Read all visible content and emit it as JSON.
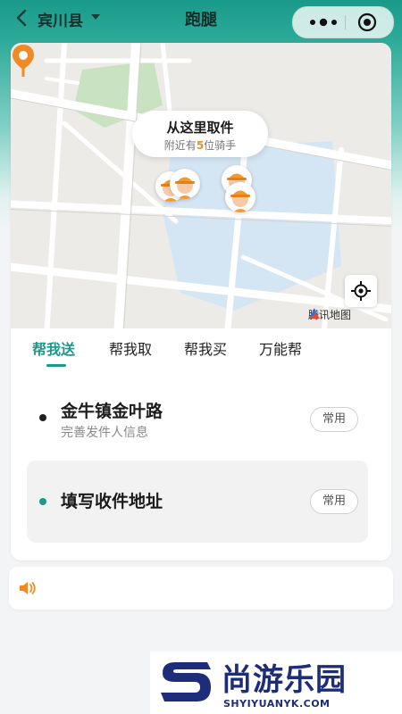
{
  "header": {
    "city": "宾川县",
    "title": "跑腿"
  },
  "map": {
    "pickup_title": "从这里取件",
    "pickup_sub_prefix": "附近有",
    "pickup_count": "5",
    "pickup_sub_suffix": "位骑手",
    "logo_text": "腾讯地图"
  },
  "tabs": [
    {
      "label": "帮我送",
      "active": true
    },
    {
      "label": "帮我取",
      "active": false
    },
    {
      "label": "帮我买",
      "active": false
    },
    {
      "label": "万能帮",
      "active": false
    }
  ],
  "sender": {
    "address": "金牛镇金叶路",
    "hint": "完善发件人信息",
    "common_label": "常用"
  },
  "receiver": {
    "address": "填写收件地址",
    "common_label": "常用"
  },
  "colors": {
    "brand": "#1a9a8a",
    "accent": "#f08a24"
  },
  "icons": {
    "back": "chevron-left-icon",
    "dropdown": "caret-down-icon",
    "more": "more-dots-icon",
    "close": "target-close-icon",
    "locate": "crosshair-icon",
    "notice": "speaker-icon"
  },
  "watermark": {
    "text": "尚游乐园",
    "url": "SHYIYUANYK.COM"
  }
}
